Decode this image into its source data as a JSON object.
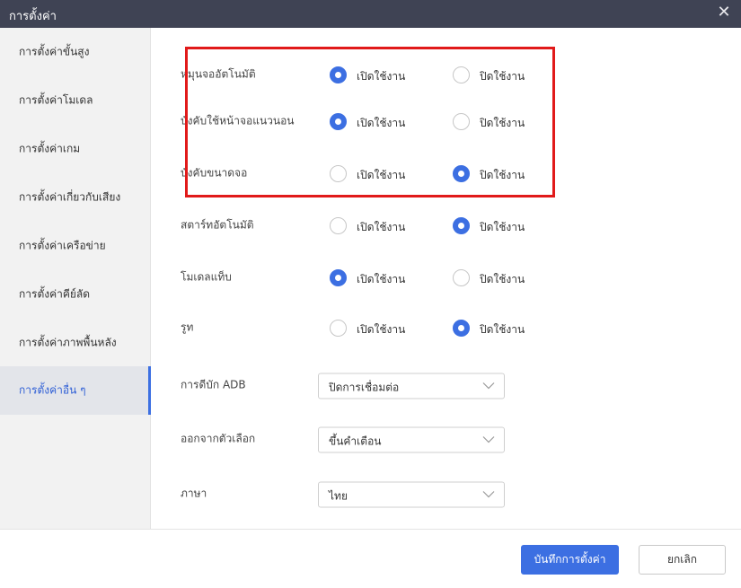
{
  "window": {
    "title": "การตั้งค่า",
    "close_icon": "close-icon"
  },
  "sidebar": {
    "items": [
      {
        "label": "การตั้งค่าขั้นสูง",
        "active": false
      },
      {
        "label": "การตั้งค่าโมเดล",
        "active": false
      },
      {
        "label": "การตั้งค่าเกม",
        "active": false
      },
      {
        "label": "การตั้งค่าเกี่ยวกับเสียง",
        "active": false
      },
      {
        "label": "การตั้งค่าเครือข่าย",
        "active": false
      },
      {
        "label": "การตั้งค่าคีย์ลัด",
        "active": false
      },
      {
        "label": "การตั้งค่าภาพพื้นหลัง",
        "active": false
      },
      {
        "label": "การตั้งค่าอื่น ๆ",
        "active": true
      }
    ]
  },
  "settings": {
    "rows": [
      {
        "label": "หมุนจออัตโนมัติ",
        "option_on": "เปิดใช้งาน",
        "option_off": "ปิดใช้งาน",
        "selected": "on"
      },
      {
        "label": "บังคับใช้หน้าจอแนวนอน",
        "option_on": "เปิดใช้งาน",
        "option_off": "ปิดใช้งาน",
        "selected": "on"
      },
      {
        "label": "บังคับขนาดจอ",
        "option_on": "เปิดใช้งาน",
        "option_off": "ปิดใช้งาน",
        "selected": "off"
      },
      {
        "label": "สตาร์ทอัตโนมัติ",
        "option_on": "เปิดใช้งาน",
        "option_off": "ปิดใช้งาน",
        "selected": "off"
      },
      {
        "label": "โมเดลแท็บ",
        "option_on": "เปิดใช้งาน",
        "option_off": "ปิดใช้งาน",
        "selected": "on"
      },
      {
        "label": "รูท",
        "option_on": "เปิดใช้งาน",
        "option_off": "ปิดใช้งาน",
        "selected": "off"
      }
    ],
    "selects": [
      {
        "label": "การดีบัก ADB",
        "value": "ปิดการเชื่อมต่อ"
      },
      {
        "label": "ออกจากตัวเลือก",
        "value": "ขึ้นคำเตือน"
      },
      {
        "label": "ภาษา",
        "value": "ไทย"
      }
    ]
  },
  "footer": {
    "save_label": "บันทึกการตั้งค่า",
    "cancel_label": "ยกเลิก"
  },
  "colors": {
    "accent": "#3c6fe2",
    "titlebar": "#3f4354",
    "highlight": "#e11a1a",
    "sidebar_bg": "#f2f2f2"
  }
}
